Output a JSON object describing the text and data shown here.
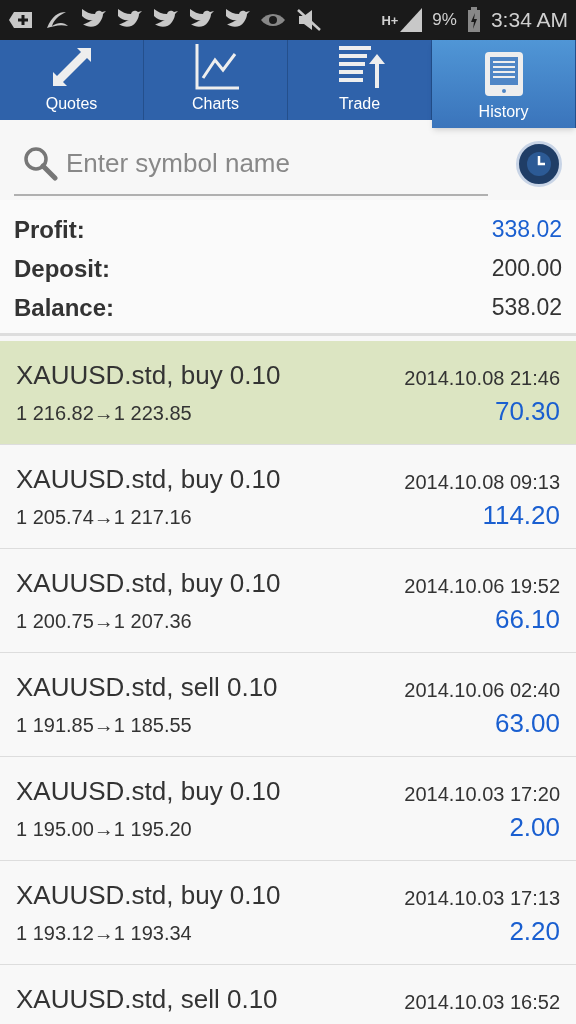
{
  "status_bar": {
    "network": "H+",
    "battery": "9%",
    "time": "3:34 AM"
  },
  "tabs": [
    {
      "label": "Quotes",
      "kind": "quotes",
      "selected": false
    },
    {
      "label": "Charts",
      "kind": "charts",
      "selected": false
    },
    {
      "label": "Trade",
      "kind": "trade",
      "selected": false
    },
    {
      "label": "History",
      "kind": "history",
      "selected": true
    }
  ],
  "search": {
    "placeholder": "Enter symbol name"
  },
  "summary": [
    {
      "label": "Profit:",
      "value": "338.02",
      "kind": "profit"
    },
    {
      "label": "Deposit:",
      "value": "200.00",
      "kind": "plain"
    },
    {
      "label": "Balance:",
      "value": "538.02",
      "kind": "plain"
    }
  ],
  "trades": [
    {
      "title": "XAUUSD.std, buy 0.10",
      "time": "2014.10.08 21:46",
      "prices": "1 216.82→1 223.85",
      "profit": "70.30",
      "selected": true
    },
    {
      "title": "XAUUSD.std, buy 0.10",
      "time": "2014.10.08 09:13",
      "prices": "1 205.74→1 217.16",
      "profit": "114.20",
      "selected": false
    },
    {
      "title": "XAUUSD.std, buy 0.10",
      "time": "2014.10.06 19:52",
      "prices": "1 200.75→1 207.36",
      "profit": "66.10",
      "selected": false
    },
    {
      "title": "XAUUSD.std, sell 0.10",
      "time": "2014.10.06 02:40",
      "prices": "1 191.85→1 185.55",
      "profit": "63.00",
      "selected": false
    },
    {
      "title": "XAUUSD.std, buy 0.10",
      "time": "2014.10.03 17:20",
      "prices": "1 195.00→1 195.20",
      "profit": "2.00",
      "selected": false
    },
    {
      "title": "XAUUSD.std, buy 0.10",
      "time": "2014.10.03 17:13",
      "prices": "1 193.12→1 193.34",
      "profit": "2.20",
      "selected": false
    },
    {
      "title": "XAUUSD.std, sell 0.10",
      "time": "2014.10.03 16:52",
      "selected": false
    }
  ]
}
